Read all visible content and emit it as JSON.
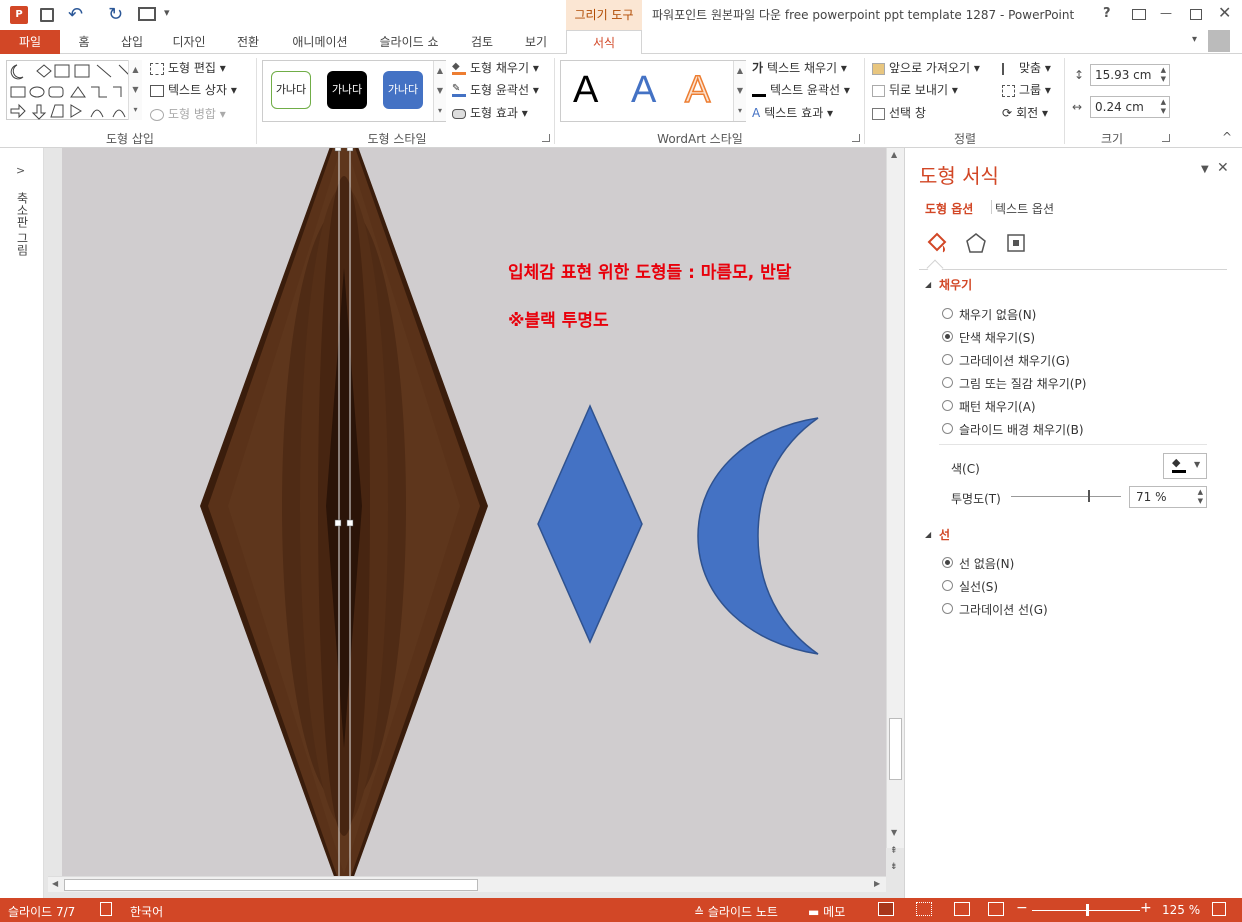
{
  "title": {
    "window": "파워포인트 원본파일 다운 free powerpoint ppt template 1287 - PowerPoint",
    "context_tab": "그리기 도구",
    "help": "?",
    "min": "—"
  },
  "tabs": [
    "파일",
    "홈",
    "삽입",
    "디자인",
    "전환",
    "애니메이션",
    "슬라이드 쇼",
    "검토",
    "보기",
    "서식"
  ],
  "ribbon": {
    "insert_shapes": {
      "label": "도형 삽입",
      "edit_shape": "도형 편집",
      "text_box": "텍스트 상자",
      "merge_shapes": "도형 병합"
    },
    "shape_styles": {
      "label": "도형 스타일",
      "samples": [
        "가나다",
        "가나다",
        "가나다"
      ],
      "fill": "도형 채우기",
      "outline": "도형 윤곽선",
      "effects": "도형 효과"
    },
    "wordart": {
      "label": "WordArt 스타일",
      "sample": "A",
      "text_fill": "텍스트 채우기",
      "text_outline": "텍스트 윤곽선",
      "text_effects": "텍스트 효과",
      "text_fill_icon": "가"
    },
    "arrange": {
      "label": "정렬",
      "bring_forward": "앞으로 가져오기",
      "send_backward": "뒤로 보내기",
      "selection_pane": "선택 창",
      "align": "맞춤",
      "group": "그룹",
      "rotate": "회전"
    },
    "size": {
      "label": "크기",
      "height": "15.93 cm",
      "width": "0.24 cm"
    }
  },
  "leftpane": {
    "label": "축소판 그림"
  },
  "slide": {
    "text1": "입체감 표현 위한 도형들 : 마름모, 반달",
    "text2": "※블랙 투명도"
  },
  "format_pane": {
    "title": "도형 서식",
    "tab_shape": "도형 옵션",
    "tab_text": "텍스트 옵션",
    "fill_section": "채우기",
    "fill_options": [
      {
        "label": "채우기 없음(N)",
        "checked": false
      },
      {
        "label": "단색 채우기(S)",
        "checked": true
      },
      {
        "label": "그라데이션 채우기(G)",
        "checked": false
      },
      {
        "label": "그림 또는 질감 채우기(P)",
        "checked": false
      },
      {
        "label": "패턴 채우기(A)",
        "checked": false
      },
      {
        "label": "슬라이드 배경 채우기(B)",
        "checked": false
      }
    ],
    "color_label": "색(C)",
    "transparency_label": "투명도(T)",
    "transparency_value": "71 %",
    "line_section": "선",
    "line_options": [
      {
        "label": "선 없음(N)",
        "checked": true
      },
      {
        "label": "실선(S)",
        "checked": false
      },
      {
        "label": "그라데이션 선(G)",
        "checked": false
      }
    ]
  },
  "status": {
    "slide": "슬라이드 7/7",
    "language": "한국어",
    "notes": "슬라이드 노트",
    "comments": "메모",
    "zoom": "125 %"
  },
  "colors": {
    "accent": "#d24726",
    "shape_blue": "#4472c4",
    "brown": "#5a3219",
    "red_text": "#e8000b"
  }
}
